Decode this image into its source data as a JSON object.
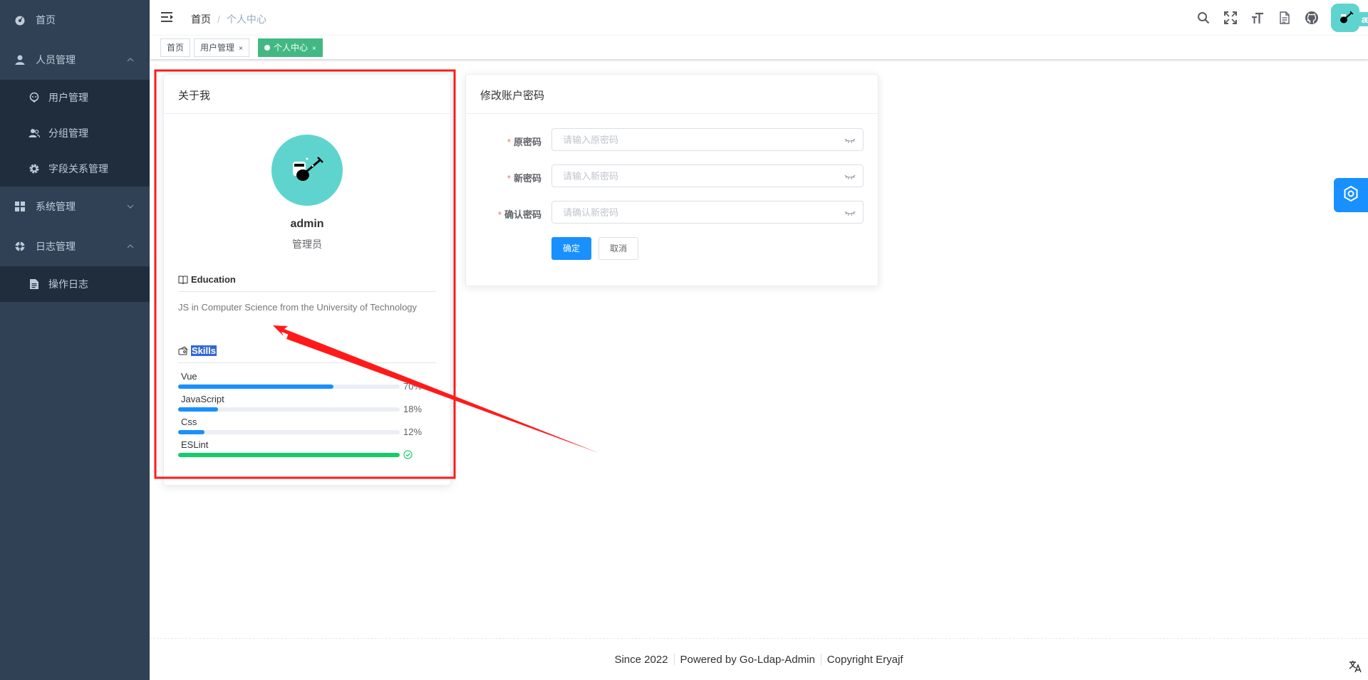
{
  "sidebar": {
    "home": "首页",
    "personnel": "人员管理",
    "user_mgmt": "用户管理",
    "group_mgmt": "分组管理",
    "field_mgmt": "字段关系管理",
    "system": "系统管理",
    "logs": "日志管理",
    "op_log": "操作日志"
  },
  "navbar": {
    "breadcrumb_home": "首页",
    "breadcrumb_sep": "/",
    "breadcrumb_current": "个人中心"
  },
  "tags": [
    {
      "label": "首页"
    },
    {
      "label": "用户管理",
      "close": "×"
    },
    {
      "label": "个人中心",
      "close": "×"
    }
  ],
  "about": {
    "title": "关于我",
    "name": "admin",
    "role": "管理员",
    "education_title": "Education",
    "education_text": "JS in Computer Science from the University of Technology",
    "skills_title": "Skills",
    "skills": [
      {
        "name": "Vue",
        "percent": 70,
        "label": "70%"
      },
      {
        "name": "JavaScript",
        "percent": 18,
        "label": "18%"
      },
      {
        "name": "Css",
        "percent": 12,
        "label": "12%"
      },
      {
        "name": "ESLint",
        "percent": 100,
        "label": ""
      }
    ]
  },
  "password": {
    "title": "修改账户密码",
    "old_label": "原密码",
    "old_placeholder": "请输入原密码",
    "new_label": "新密码",
    "new_placeholder": "请输入新密码",
    "confirm_label": "确认密码",
    "confirm_placeholder": "请确认新密码",
    "required_mark": "*",
    "submit": "确定",
    "cancel": "取消"
  },
  "footer": {
    "since": "Since 2022",
    "powered": "Powered by Go-Ldap-Admin",
    "copyright": "Copyright Eryajf"
  },
  "colors": {
    "sidebar_bg": "#304156",
    "submenu_bg": "#1f2d3d",
    "primary": "#1890ff",
    "tag_active": "#42b983",
    "avatar_bg": "#5fd4cf",
    "annotation": "#ff0000"
  }
}
